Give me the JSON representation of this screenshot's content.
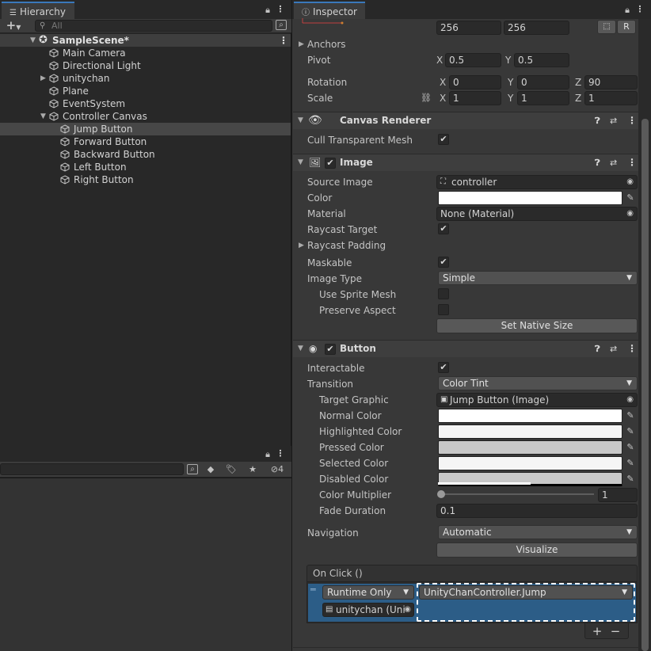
{
  "hierarchy": {
    "tab_label": "Hierarchy",
    "search_placeholder": "All",
    "scene": "SampleScene*",
    "items": [
      {
        "label": "Main Camera"
      },
      {
        "label": "Directional Light"
      },
      {
        "label": "unitychan"
      },
      {
        "label": "Plane"
      },
      {
        "label": "EventSystem"
      },
      {
        "label": "Controller Canvas"
      },
      {
        "label": "Jump Button"
      },
      {
        "label": "Forward Button"
      },
      {
        "label": "Backward Button"
      },
      {
        "label": "Left Button"
      },
      {
        "label": "Right Button"
      }
    ]
  },
  "bottom_panel": {
    "visibility_count": "4"
  },
  "inspector": {
    "tab_label": "Inspector",
    "rect_transform": {
      "width_value": "256",
      "height_value": "256",
      "r_label": "R",
      "anchors_label": "Anchors",
      "pivot_label": "Pivot",
      "pivot_x": "0.5",
      "pivot_y": "0.5",
      "rotation_label": "Rotation",
      "rotation_x": "0",
      "rotation_y": "0",
      "rotation_z": "90",
      "scale_label": "Scale",
      "scale_x": "1",
      "scale_y": "1",
      "scale_z": "1",
      "axis_x": "X",
      "axis_y": "Y",
      "axis_z": "Z"
    },
    "canvas_renderer": {
      "title": "Canvas Renderer",
      "cull_label": "Cull Transparent Mesh"
    },
    "image": {
      "title": "Image",
      "source_image_label": "Source Image",
      "source_image_value": "controller",
      "color_label": "Color",
      "material_label": "Material",
      "material_value": "None (Material)",
      "raycast_target_label": "Raycast Target",
      "raycast_padding_label": "Raycast Padding",
      "maskable_label": "Maskable",
      "image_type_label": "Image Type",
      "image_type_value": "Simple",
      "use_sprite_mesh_label": "Use Sprite Mesh",
      "preserve_aspect_label": "Preserve Aspect",
      "set_native_size_label": "Set Native Size"
    },
    "button": {
      "title": "Button",
      "interactable_label": "Interactable",
      "transition_label": "Transition",
      "transition_value": "Color Tint",
      "target_graphic_label": "Target Graphic",
      "target_graphic_value": "Jump Button (Image)",
      "normal_color_label": "Normal Color",
      "highlighted_color_label": "Highlighted Color",
      "pressed_color_label": "Pressed Color",
      "selected_color_label": "Selected Color",
      "disabled_color_label": "Disabled Color",
      "color_multiplier_label": "Color Multiplier",
      "color_multiplier_value": "1",
      "fade_duration_label": "Fade Duration",
      "fade_duration_value": "0.1",
      "navigation_label": "Navigation",
      "navigation_value": "Automatic",
      "visualize_label": "Visualize",
      "on_click_label": "On Click ()",
      "runtime_value": "Runtime Only",
      "function_value": "UnityChanController.Jump",
      "object_value": "unitychan (Uni",
      "plus_label": "+",
      "minus_label": "−"
    }
  },
  "colors": {
    "accent": "#3a79bb",
    "selected_row": "#474747",
    "event_row": "#2c5d87",
    "color_white": "#ffffff",
    "color_pressed": "#c8c8c8",
    "color_disabled": "#c8c8c8"
  }
}
